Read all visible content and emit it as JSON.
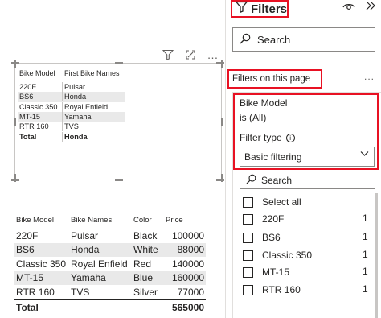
{
  "visual_header": {
    "icons": [
      "filter-icon",
      "focus-mode-icon",
      "more-options-icon"
    ],
    "more_label": "…"
  },
  "small_table": {
    "columns": [
      "Bike Model",
      "First Bike Names"
    ],
    "rows": [
      [
        "220F",
        "Pulsar"
      ],
      [
        "BS6",
        "Honda"
      ],
      [
        "Classic 350",
        "Royal Enfield"
      ],
      [
        "MT-15",
        "Yamaha"
      ],
      [
        "RTR 160",
        "TVS"
      ]
    ],
    "total": [
      "Total",
      "Honda"
    ]
  },
  "main_table": {
    "columns": [
      "Bike Model",
      "Bike Names",
      "Color",
      "Price"
    ],
    "rows": [
      [
        "220F",
        "Pulsar",
        "Black",
        "100000"
      ],
      [
        "BS6",
        "Honda",
        "White",
        "88000"
      ],
      [
        "Classic 350",
        "Royal Enfield",
        "Red",
        "140000"
      ],
      [
        "MT-15",
        "Yamaha",
        "Blue",
        "160000"
      ],
      [
        "RTR 160",
        "TVS",
        "Silver",
        "77000"
      ]
    ],
    "total": [
      "Total",
      "",
      "",
      "565000"
    ]
  },
  "filters_pane": {
    "title": "Filters",
    "search_placeholder": "Search",
    "section_title": "Filters on this page",
    "section_more": "...",
    "card": {
      "field": "Bike Model",
      "state": "is (All)",
      "filter_type_label": "Filter type",
      "filter_type_value": "Basic filtering",
      "search_placeholder": "Search",
      "select_all": "Select all",
      "options": [
        {
          "label": "220F",
          "count": "1"
        },
        {
          "label": "BS6",
          "count": "1"
        },
        {
          "label": "Classic 350",
          "count": "1"
        },
        {
          "label": "MT-15",
          "count": "1"
        },
        {
          "label": "RTR 160",
          "count": "1"
        }
      ]
    }
  },
  "colors": {
    "highlight_border": "#e81123",
    "alt_row": "#e9e9e9",
    "text": "#252423"
  }
}
